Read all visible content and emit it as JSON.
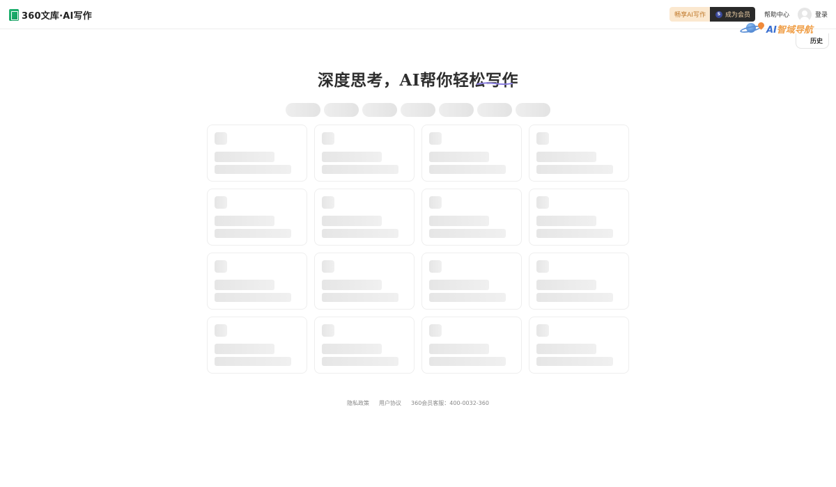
{
  "header": {
    "logo_text": "360文库·AI写作",
    "enjoy_ai_label": "畅享AI写作",
    "member_label": "成为会员",
    "member_icon_char": "S",
    "help_label": "帮助中心",
    "login_label": "登录"
  },
  "badge": {
    "ai_text": "AI",
    "nav_text": "智域导航"
  },
  "history_label": "历史",
  "main": {
    "title": "深度思考，AI帮你轻松写作"
  },
  "skeleton": {
    "tab_count": 7,
    "card_count": 16
  },
  "footer": {
    "privacy": "隐私政策",
    "agreement": "用户协议",
    "service": "360会员客服：400-0032-360"
  },
  "colors": {
    "accent_orange": "#c07a2c",
    "member_bg": "#2a2a2a",
    "logo_green": "#21b573",
    "underline_purple": "#8a7ee0"
  }
}
